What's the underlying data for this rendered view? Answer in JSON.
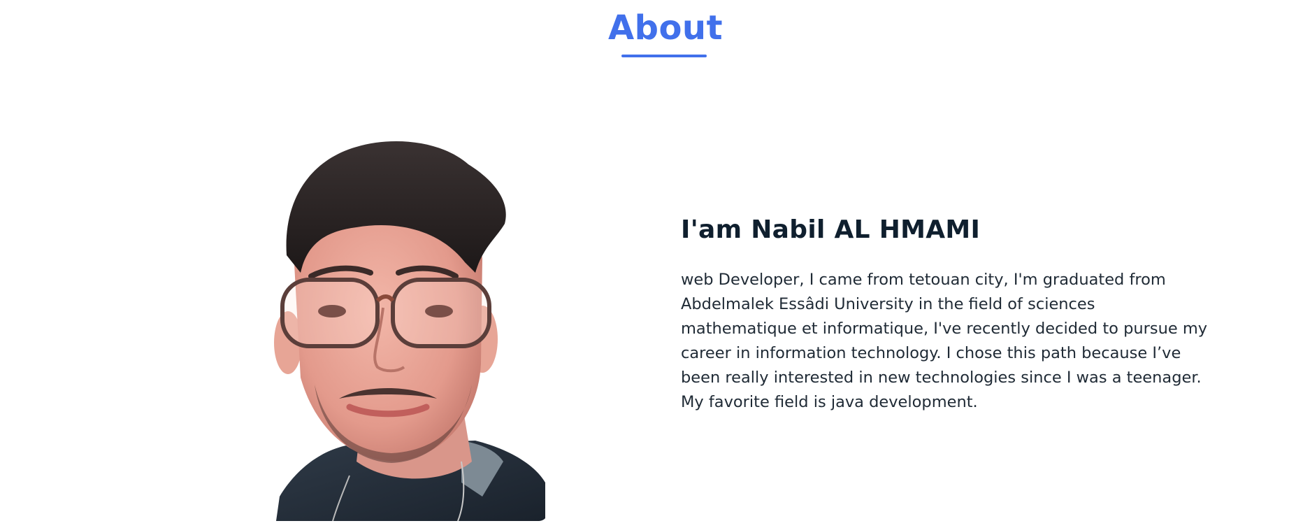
{
  "section": {
    "title": "About"
  },
  "profile": {
    "heading": "I'am Nabil AL HMAMI",
    "bio": "web Developer, I came from tetouan city, I'm graduated from Abdelmalek Essâdi University in the field of sciences mathematique et informatique, I've recently decided to pursue my career in information technology. I chose this path because I’ve been really interested in new technologies since I was a teenager. My favorite field is java development.",
    "photo_icon": "portrait-photo"
  },
  "colors": {
    "accent": "#4170eb",
    "heading": "#0f1f2e",
    "body_text": "#1f2a35",
    "background": "#ffffff"
  }
}
